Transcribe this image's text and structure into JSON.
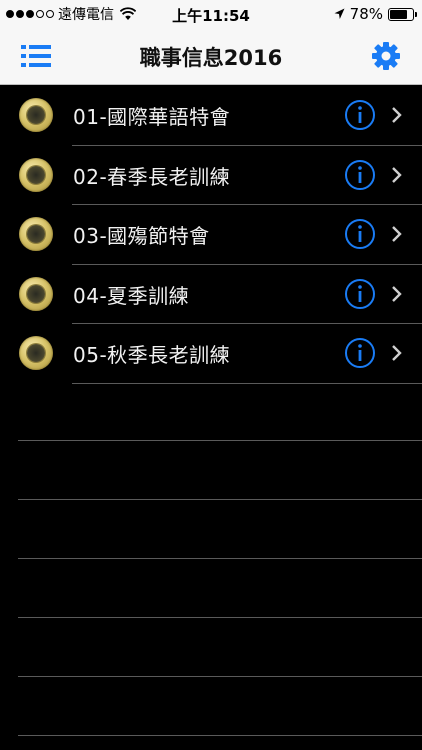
{
  "status_bar": {
    "carrier": "遠傳電信",
    "time": "上午11:54",
    "battery": "78%",
    "battery_level": 0.78,
    "signal_bars_filled": 3,
    "signal_bars_total": 5
  },
  "nav": {
    "title": "職事信息2016",
    "left_icon": "list-icon",
    "right_icon": "gear-icon",
    "accent_color": "#1a7cf5"
  },
  "items": [
    {
      "label": "01-國際華語特會"
    },
    {
      "label": "02-春季長老訓練"
    },
    {
      "label": "03-國殤節特會"
    },
    {
      "label": "04-夏季訓練"
    },
    {
      "label": "05-秋季長老訓練"
    }
  ]
}
